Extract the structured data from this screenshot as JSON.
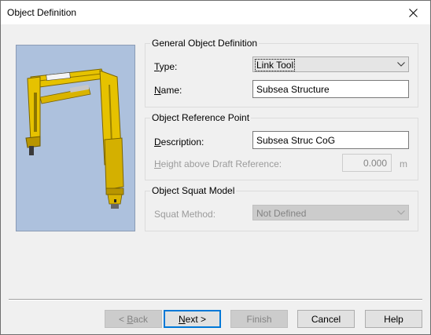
{
  "window": {
    "title": "Object Definition",
    "close_label": "✕"
  },
  "general_group": {
    "title": "General Object Definition",
    "type_label_acc": "T",
    "type_label_rest": "ype:",
    "type_value": "Link Tool",
    "name_label_acc": "N",
    "name_label_rest": "ame:",
    "name_value": "Subsea Structure"
  },
  "reference_group": {
    "title": "Object Reference Point",
    "description_label_acc": "D",
    "description_label_rest": "escription:",
    "description_value": "Subsea Struc CoG",
    "height_label_acc": "H",
    "height_label_rest": "eight above Draft Reference:",
    "height_value": "0.000",
    "height_unit": "m"
  },
  "squat_group": {
    "title": "Object Squat Model",
    "method_label": "Squat Method:",
    "method_value": "Not Defined"
  },
  "buttons": {
    "back_prefix": "< ",
    "back_acc": "B",
    "back_rest": "ack",
    "next_acc": "N",
    "next_rest": "ext >",
    "finish": "Finish",
    "cancel": "Cancel",
    "help": "Help"
  },
  "colors": {
    "image_background": "#adc1dd",
    "crane_yellow": "#e6c200",
    "default_button_border": "#0078d7"
  }
}
